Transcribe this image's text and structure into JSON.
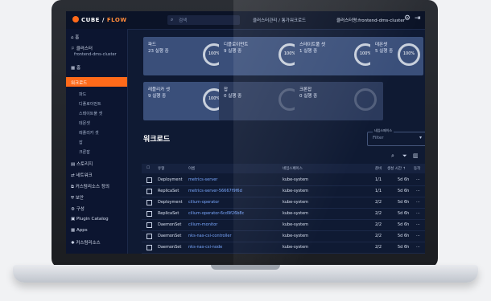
{
  "topbar": {
    "logo_main": "CUBE",
    "logo_sep": "/",
    "logo_sub": "FLOW",
    "search_placeholder": "검색",
    "breadcrumb": "클러스터관리  /  통가워크로드",
    "cluster_name": "클러스터명:frontend-dms-cluster"
  },
  "sidebar": {
    "home": "홈",
    "cluster": "클러스터",
    "cluster_value": "frontend-dms-cluster",
    "dashboard": "홈",
    "workload_active": "워크로드",
    "sub_items": [
      "파드",
      "디플로이먼트",
      "스테이트풀 셋",
      "데몬셋",
      "레플리카 셋",
      "잡",
      "크론잡"
    ],
    "items": [
      "스토리지",
      "네트워크",
      "커스텀리소스 정의",
      "보안",
      "구성",
      "Plugin Catalog",
      "Apps",
      "커스텀리소스"
    ]
  },
  "cards": [
    {
      "title": "파드",
      "status": "23 실행 중",
      "percent": "100%"
    },
    {
      "title": "디플로이먼트",
      "status": "9 실행 중",
      "percent": "100%"
    },
    {
      "title": "스테이트풀 셋",
      "status": "1 실행 중",
      "percent": "100%"
    },
    {
      "title": "데몬셋",
      "status": "5 실행 중",
      "percent": "100%"
    },
    {
      "title": "레플리카 셋",
      "status": "9 실행 중",
      "percent": "100%"
    },
    {
      "title": "잡",
      "status": "0 실행 중",
      "percent": ""
    },
    {
      "title": "크론잡",
      "status": "0 실행 중",
      "percent": ""
    }
  ],
  "section": {
    "title": "워크로드",
    "filter_label": "네임스페이스",
    "filter_placeholder": "Filter"
  },
  "table": {
    "headers": [
      "유형",
      "이름",
      "네임스페이스",
      "준비",
      "생성 시간 ↑",
      "동작"
    ],
    "rows": [
      {
        "kind": "Deployment",
        "name": "metrics-server",
        "ns": "kube-system",
        "ready": "1/1",
        "age": "5d 6h",
        "more": "⋯"
      },
      {
        "kind": "ReplicaSet",
        "name": "metrics-server-56667f9f6d",
        "ns": "kube-system",
        "ready": "1/1",
        "age": "5d 6h",
        "more": "⋯"
      },
      {
        "kind": "Deployment",
        "name": "cilium-operator",
        "ns": "kube-system",
        "ready": "2/2",
        "age": "5d 6h",
        "more": "⋯"
      },
      {
        "kind": "ReplicaSet",
        "name": "cilium-operator-6cd9f26b8c",
        "ns": "kube-system",
        "ready": "2/2",
        "age": "5d 6h",
        "more": "⋯"
      },
      {
        "kind": "DaemonSet",
        "name": "cilium-monitor",
        "ns": "kube-system",
        "ready": "2/2",
        "age": "5d 6h",
        "more": "⋯"
      },
      {
        "kind": "DaemonSet",
        "name": "nks-nas-csi-controller",
        "ns": "kube-system",
        "ready": "2/2",
        "age": "5d 6h",
        "more": "⋯"
      },
      {
        "kind": "DaemonSet",
        "name": "nks-nas-csi-node",
        "ns": "kube-system",
        "ready": "2/2",
        "age": "5d 6h",
        "more": "⋯"
      }
    ]
  },
  "colors": {
    "accent": "#ff6a1a",
    "card": "#3a4f7a",
    "link": "#7aa8ff",
    "background": "#0f1a33"
  }
}
